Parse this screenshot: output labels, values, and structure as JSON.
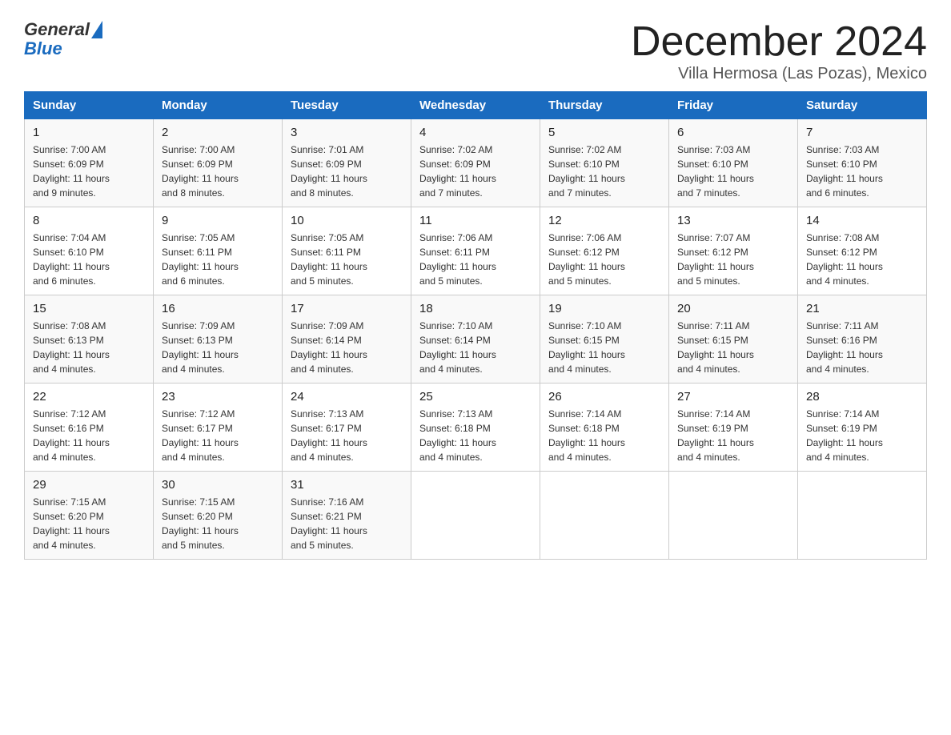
{
  "header": {
    "logo_general": "General",
    "logo_blue": "Blue",
    "month_title": "December 2024",
    "location": "Villa Hermosa (Las Pozas), Mexico"
  },
  "weekdays": [
    "Sunday",
    "Monday",
    "Tuesday",
    "Wednesday",
    "Thursday",
    "Friday",
    "Saturday"
  ],
  "weeks": [
    [
      {
        "day": "1",
        "sunrise": "7:00 AM",
        "sunset": "6:09 PM",
        "daylight": "11 hours and 9 minutes."
      },
      {
        "day": "2",
        "sunrise": "7:00 AM",
        "sunset": "6:09 PM",
        "daylight": "11 hours and 8 minutes."
      },
      {
        "day": "3",
        "sunrise": "7:01 AM",
        "sunset": "6:09 PM",
        "daylight": "11 hours and 8 minutes."
      },
      {
        "day": "4",
        "sunrise": "7:02 AM",
        "sunset": "6:09 PM",
        "daylight": "11 hours and 7 minutes."
      },
      {
        "day": "5",
        "sunrise": "7:02 AM",
        "sunset": "6:10 PM",
        "daylight": "11 hours and 7 minutes."
      },
      {
        "day": "6",
        "sunrise": "7:03 AM",
        "sunset": "6:10 PM",
        "daylight": "11 hours and 7 minutes."
      },
      {
        "day": "7",
        "sunrise": "7:03 AM",
        "sunset": "6:10 PM",
        "daylight": "11 hours and 6 minutes."
      }
    ],
    [
      {
        "day": "8",
        "sunrise": "7:04 AM",
        "sunset": "6:10 PM",
        "daylight": "11 hours and 6 minutes."
      },
      {
        "day": "9",
        "sunrise": "7:05 AM",
        "sunset": "6:11 PM",
        "daylight": "11 hours and 6 minutes."
      },
      {
        "day": "10",
        "sunrise": "7:05 AM",
        "sunset": "6:11 PM",
        "daylight": "11 hours and 5 minutes."
      },
      {
        "day": "11",
        "sunrise": "7:06 AM",
        "sunset": "6:11 PM",
        "daylight": "11 hours and 5 minutes."
      },
      {
        "day": "12",
        "sunrise": "7:06 AM",
        "sunset": "6:12 PM",
        "daylight": "11 hours and 5 minutes."
      },
      {
        "day": "13",
        "sunrise": "7:07 AM",
        "sunset": "6:12 PM",
        "daylight": "11 hours and 5 minutes."
      },
      {
        "day": "14",
        "sunrise": "7:08 AM",
        "sunset": "6:12 PM",
        "daylight": "11 hours and 4 minutes."
      }
    ],
    [
      {
        "day": "15",
        "sunrise": "7:08 AM",
        "sunset": "6:13 PM",
        "daylight": "11 hours and 4 minutes."
      },
      {
        "day": "16",
        "sunrise": "7:09 AM",
        "sunset": "6:13 PM",
        "daylight": "11 hours and 4 minutes."
      },
      {
        "day": "17",
        "sunrise": "7:09 AM",
        "sunset": "6:14 PM",
        "daylight": "11 hours and 4 minutes."
      },
      {
        "day": "18",
        "sunrise": "7:10 AM",
        "sunset": "6:14 PM",
        "daylight": "11 hours and 4 minutes."
      },
      {
        "day": "19",
        "sunrise": "7:10 AM",
        "sunset": "6:15 PM",
        "daylight": "11 hours and 4 minutes."
      },
      {
        "day": "20",
        "sunrise": "7:11 AM",
        "sunset": "6:15 PM",
        "daylight": "11 hours and 4 minutes."
      },
      {
        "day": "21",
        "sunrise": "7:11 AM",
        "sunset": "6:16 PM",
        "daylight": "11 hours and 4 minutes."
      }
    ],
    [
      {
        "day": "22",
        "sunrise": "7:12 AM",
        "sunset": "6:16 PM",
        "daylight": "11 hours and 4 minutes."
      },
      {
        "day": "23",
        "sunrise": "7:12 AM",
        "sunset": "6:17 PM",
        "daylight": "11 hours and 4 minutes."
      },
      {
        "day": "24",
        "sunrise": "7:13 AM",
        "sunset": "6:17 PM",
        "daylight": "11 hours and 4 minutes."
      },
      {
        "day": "25",
        "sunrise": "7:13 AM",
        "sunset": "6:18 PM",
        "daylight": "11 hours and 4 minutes."
      },
      {
        "day": "26",
        "sunrise": "7:14 AM",
        "sunset": "6:18 PM",
        "daylight": "11 hours and 4 minutes."
      },
      {
        "day": "27",
        "sunrise": "7:14 AM",
        "sunset": "6:19 PM",
        "daylight": "11 hours and 4 minutes."
      },
      {
        "day": "28",
        "sunrise": "7:14 AM",
        "sunset": "6:19 PM",
        "daylight": "11 hours and 4 minutes."
      }
    ],
    [
      {
        "day": "29",
        "sunrise": "7:15 AM",
        "sunset": "6:20 PM",
        "daylight": "11 hours and 4 minutes."
      },
      {
        "day": "30",
        "sunrise": "7:15 AM",
        "sunset": "6:20 PM",
        "daylight": "11 hours and 5 minutes."
      },
      {
        "day": "31",
        "sunrise": "7:16 AM",
        "sunset": "6:21 PM",
        "daylight": "11 hours and 5 minutes."
      },
      null,
      null,
      null,
      null
    ]
  ],
  "labels": {
    "sunrise": "Sunrise:",
    "sunset": "Sunset:",
    "daylight": "Daylight:"
  },
  "colors": {
    "header_bg": "#1a6bbf",
    "header_text": "#ffffff",
    "border": "#cccccc"
  }
}
